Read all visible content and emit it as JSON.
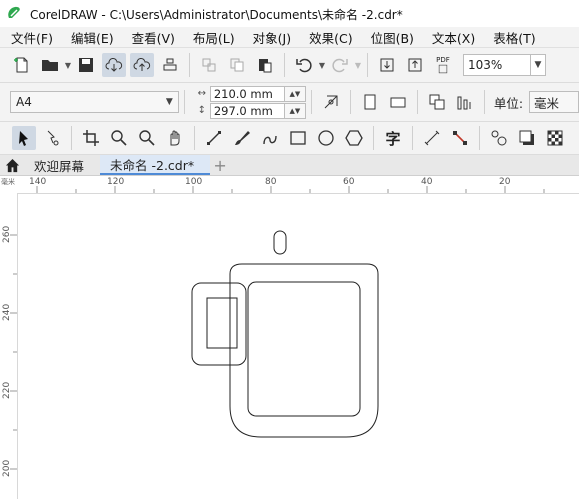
{
  "window": {
    "title": "CorelDRAW - C:\\Users\\Administrator\\Documents\\未命名 -2.cdr*"
  },
  "menu": [
    "文件(F)",
    "编辑(E)",
    "查看(V)",
    "布局(L)",
    "对象(J)",
    "效果(C)",
    "位图(B)",
    "文本(X)",
    "表格(T)"
  ],
  "standard_toolbar": {
    "zoom": "103%",
    "pdf_label": "PDF"
  },
  "property_bar": {
    "paper_size": "A4",
    "width": "210.0 mm",
    "height": "297.0 mm",
    "units_label": "单位:",
    "units_value": "毫米"
  },
  "toolbox": {
    "text_tool_glyph": "字"
  },
  "tabs": {
    "welcome": "欢迎屏幕",
    "document": "未命名 -2.cdr*"
  },
  "ruler": {
    "horizontal_labels": [
      "140",
      "120",
      "100",
      "80",
      "60",
      "40",
      "20"
    ],
    "vertical_labels": [
      "260",
      "240",
      "220",
      "200"
    ],
    "corner_label": "毫米"
  },
  "colors": {
    "accent": "#4e8ad6",
    "logo": "#2fa84f"
  }
}
